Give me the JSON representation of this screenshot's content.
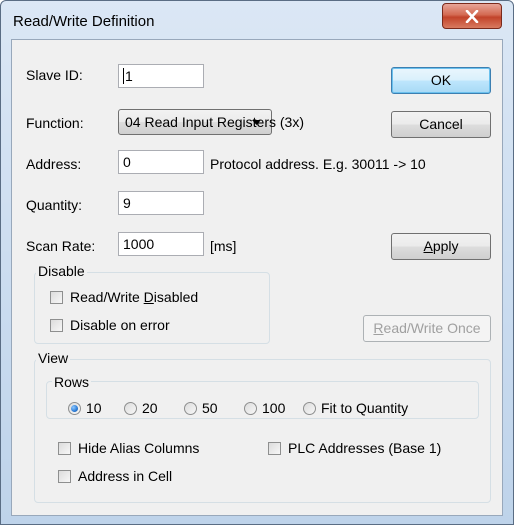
{
  "window": {
    "title": "Read/Write Definition",
    "close_icon": "close-x-icon",
    "accent": "#c2432a"
  },
  "form": {
    "slave_id_label": "Slave ID:",
    "slave_id_value": "1",
    "function_label": "Function:",
    "function_value": "04 Read Input Registers (3x)",
    "address_label": "Address:",
    "address_value": "0",
    "address_hint": "Protocol address. E.g. 30011 -> 10",
    "quantity_label": "Quantity:",
    "quantity_value": "9",
    "scan_rate_label": "Scan Rate:",
    "scan_rate_value": "1000",
    "scan_rate_unit": "[ms]"
  },
  "buttons": {
    "ok": "OK",
    "cancel": "Cancel",
    "apply_pre": "",
    "apply_key": "A",
    "apply_post": "pply",
    "rwonce_pre": "",
    "rwonce_key": "R",
    "rwonce_post": "ead/Write Once"
  },
  "disable_group": {
    "caption": "Disable",
    "rw_disabled_pre": "Read/Write ",
    "rw_disabled_key": "D",
    "rw_disabled_post": "isabled",
    "disable_on_error": "Disable on error"
  },
  "view_group": {
    "caption": "View",
    "rows_caption": "Rows",
    "rows_options": [
      "10",
      "20",
      "50",
      "100",
      "Fit to Quantity"
    ],
    "rows_selected": "10",
    "hide_alias": "Hide Alias Columns",
    "plc_addresses": "PLC Addresses (Base 1)",
    "address_in_cell": "Address in Cell"
  }
}
